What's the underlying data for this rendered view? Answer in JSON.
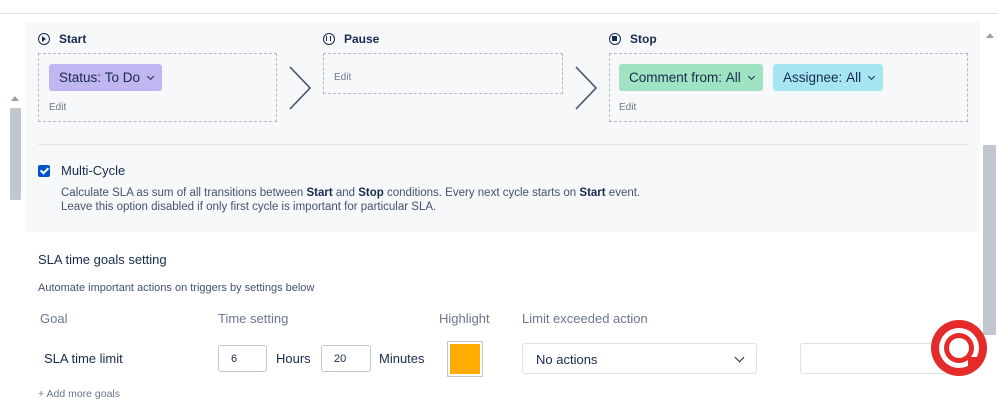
{
  "phases": {
    "start": {
      "title": "Start",
      "chips": [
        {
          "label": "Status:",
          "value": "To Do"
        }
      ],
      "edit": "Edit"
    },
    "pause": {
      "title": "Pause",
      "edit": "Edit"
    },
    "stop": {
      "title": "Stop",
      "chips": [
        {
          "label": "Comment from:",
          "value": "All"
        },
        {
          "label": "Assignee:",
          "value": "All"
        }
      ],
      "edit": "Edit"
    }
  },
  "multi_cycle": {
    "checked": true,
    "label": "Multi-Cycle",
    "desc_p1": "Calculate SLA as sum of all transitions between ",
    "desc_start": "Start",
    "desc_and": " and ",
    "desc_stop": "Stop",
    "desc_p2": " conditions. Every next cycle starts on ",
    "desc_start2": "Start",
    "desc_p3": " event.",
    "desc_line2": "Leave this option disabled if only first cycle is important for particular SLA."
  },
  "goals": {
    "title": "SLA time goals setting",
    "subtitle": "Automate important actions on triggers by settings below",
    "columns": {
      "goal": "Goal",
      "time": "Time setting",
      "highlight": "Highlight",
      "action": "Limit exceeded action"
    },
    "row": {
      "name": "SLA time limit",
      "hours": "6",
      "hours_label": "Hours",
      "minutes": "20",
      "minutes_label": "Minutes",
      "highlight_color": "#ffab00",
      "action": "No actions"
    },
    "add_more": "+ Add more goals"
  },
  "colors": {
    "accent": "#0052cc",
    "status_chip": "#c0b6f2",
    "comment_chip": "#9fe3c2",
    "assignee_chip": "#a6e6f0",
    "help_button": "#e52a2a"
  },
  "icons": {
    "start": "play-icon",
    "pause": "pause-icon",
    "stop": "stop-icon",
    "help": "help-lifebuoy-icon"
  }
}
